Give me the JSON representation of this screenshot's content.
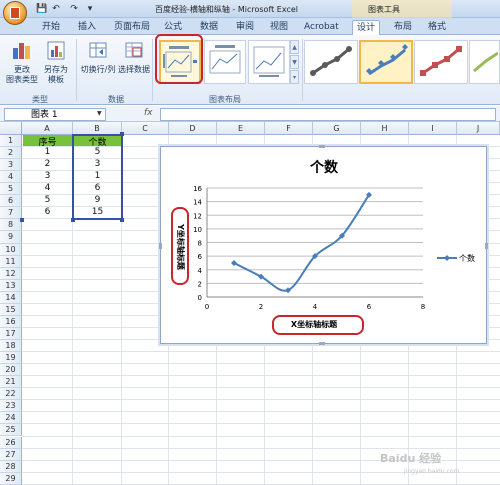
{
  "window": {
    "title": "百度经验-横轴和纵轴 - Microsoft Excel",
    "tools_label": "图表工具",
    "qat": [
      "💾",
      "↶",
      "↷",
      "▾"
    ]
  },
  "tabs": [
    {
      "label": "开始",
      "active": false
    },
    {
      "label": "插入",
      "active": false
    },
    {
      "label": "页面布局",
      "active": false
    },
    {
      "label": "公式",
      "active": false
    },
    {
      "label": "数据",
      "active": false
    },
    {
      "label": "审阅",
      "active": false
    },
    {
      "label": "视图",
      "active": false
    },
    {
      "label": "Acrobat",
      "active": false
    },
    {
      "label": "设计",
      "active": true
    },
    {
      "label": "布局",
      "active": false
    },
    {
      "label": "格式",
      "active": false
    }
  ],
  "ribbon": {
    "type_group": {
      "label": "类型",
      "change_type_line1": "更改",
      "change_type_line2": "图表类型",
      "save_template_line1": "另存为",
      "save_template_line2": "模板"
    },
    "data_group": {
      "label": "数据",
      "switch_row_col": "切换行/列",
      "select_data": "选择数据"
    },
    "layout_group": {
      "label": "图表布局"
    }
  },
  "formula_bar": {
    "name_box": "图表 1",
    "fx": "fx",
    "formula": ""
  },
  "grid": {
    "columns": [
      "A",
      "B",
      "C",
      "D",
      "E",
      "F",
      "G",
      "H",
      "I",
      "J"
    ],
    "rows": [
      "1",
      "2",
      "3",
      "4",
      "5",
      "6",
      "7",
      "8",
      "9",
      "10",
      "11",
      "12",
      "13",
      "14",
      "15",
      "16",
      "17",
      "18",
      "19",
      "20",
      "21",
      "22",
      "23",
      "24",
      "25",
      "26",
      "27",
      "28",
      "29"
    ],
    "table": {
      "headers": [
        "序号",
        "个数"
      ],
      "rows": [
        [
          "1",
          "5"
        ],
        [
          "2",
          "3"
        ],
        [
          "3",
          "1"
        ],
        [
          "4",
          "6"
        ],
        [
          "5",
          "9"
        ],
        [
          "6",
          "15"
        ]
      ]
    }
  },
  "chart_data": {
    "type": "scatter",
    "title": "个数",
    "xlabel": "X坐标轴标题",
    "ylabel": "Y坐标轴标题",
    "series": [
      {
        "name": "个数",
        "x": [
          1,
          2,
          3,
          4,
          5,
          6
        ],
        "values": [
          5,
          3,
          1,
          6,
          9,
          15
        ],
        "smooth": true
      }
    ],
    "xlim": [
      0,
      8
    ],
    "ylim": [
      0,
      16
    ],
    "xticks": [
      0,
      2,
      4,
      6,
      8
    ],
    "yticks": [
      0,
      2,
      4,
      6,
      8,
      10,
      12,
      14,
      16
    ],
    "grid": true,
    "legend_position": "right",
    "colors": {
      "series": "#4a7ebb",
      "highlight": "#c8262c"
    }
  },
  "watermark": {
    "text": "Baidu 经验",
    "sub": "jingyan.baidu.com"
  }
}
